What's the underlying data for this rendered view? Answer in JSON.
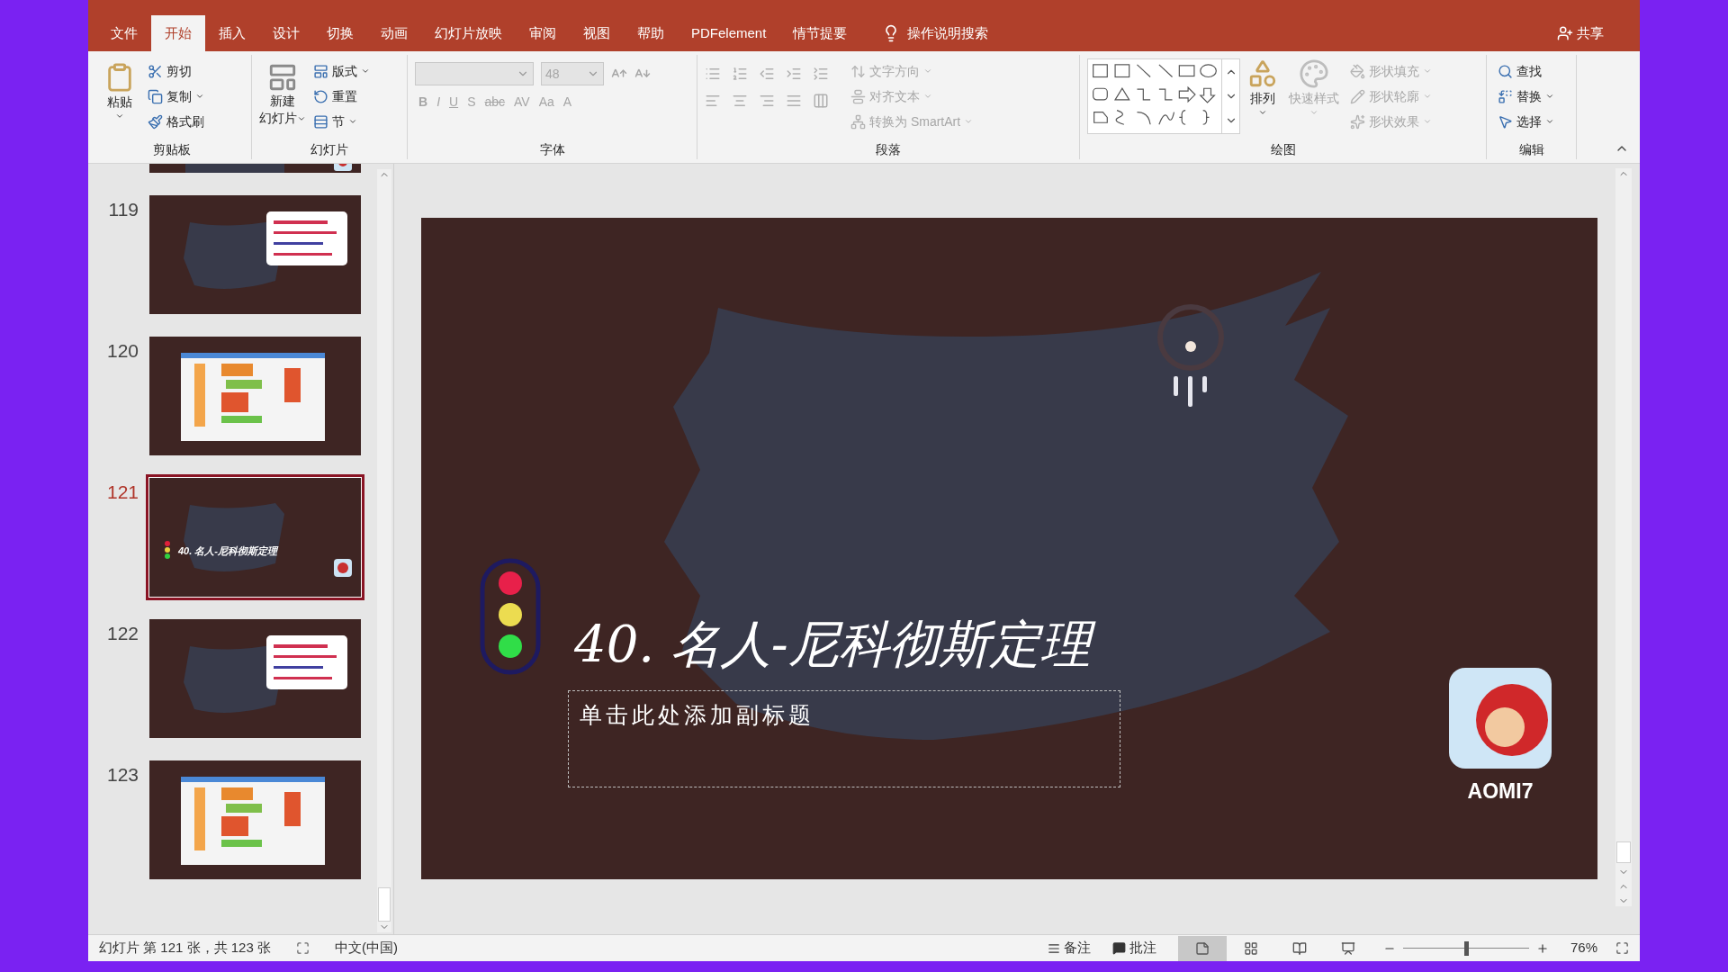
{
  "tabs": [
    {
      "label": "文件",
      "selected": false
    },
    {
      "label": "开始",
      "selected": true
    },
    {
      "label": "插入",
      "selected": false
    },
    {
      "label": "设计",
      "selected": false
    },
    {
      "label": "切换",
      "selected": false
    },
    {
      "label": "动画",
      "selected": false
    },
    {
      "label": "幻灯片放映",
      "selected": false
    },
    {
      "label": "审阅",
      "selected": false
    },
    {
      "label": "视图",
      "selected": false
    },
    {
      "label": "帮助",
      "selected": false
    },
    {
      "label": "PDFelement",
      "selected": false
    },
    {
      "label": "情节提要",
      "selected": false
    }
  ],
  "tell_me": "操作说明搜索",
  "share": "共享",
  "ribbon": {
    "clipboard": {
      "label": "剪贴板",
      "paste": "粘贴",
      "items": [
        {
          "kind": "cut",
          "label": "剪切",
          "disabled": false
        },
        {
          "kind": "copy",
          "label": "复制",
          "disabled": false
        },
        {
          "kind": "brush",
          "label": "格式刷",
          "disabled": false
        }
      ]
    },
    "slides": {
      "label": "幻灯片",
      "new_slide": [
        "新建",
        "幻灯片"
      ],
      "items": [
        {
          "kind": "layout",
          "label": "版式",
          "disabled": false
        },
        {
          "kind": "reset",
          "label": "重置",
          "disabled": false
        },
        {
          "kind": "section",
          "label": "节",
          "disabled": false
        }
      ]
    },
    "font": {
      "label": "字体",
      "size": "48",
      "disabled": true,
      "buttons": [
        "B",
        "I",
        "U",
        "S",
        "abc",
        "AV",
        "Aa",
        "A"
      ]
    },
    "paragraph": {
      "label": "段落",
      "items": [
        {
          "kind": "direction",
          "label": "文字方向",
          "disabled": true
        },
        {
          "kind": "align",
          "label": "对齐文本",
          "disabled": true
        },
        {
          "kind": "smartart",
          "label": "转换为 SmartArt",
          "disabled": true
        }
      ]
    },
    "drawing": {
      "label": "绘图",
      "arrange": "排列",
      "quick_styles": {
        "label": "快速样式",
        "disabled": true
      },
      "items": [
        {
          "kind": "fill",
          "label": "形状填充",
          "disabled": true
        },
        {
          "kind": "outline",
          "label": "形状轮廓",
          "disabled": true
        },
        {
          "kind": "effects",
          "label": "形状效果",
          "disabled": true
        }
      ]
    },
    "editing": {
      "label": "编辑",
      "items": [
        {
          "kind": "find",
          "label": "查找"
        },
        {
          "kind": "replace",
          "label": "替换"
        },
        {
          "kind": "select",
          "label": "选择"
        }
      ]
    }
  },
  "thumbnails": [
    {
      "kind": "logo",
      "selected": false
    },
    {
      "number": "119",
      "kind": "text",
      "selected": false
    },
    {
      "number": "120",
      "kind": "screen",
      "selected": false
    },
    {
      "number": "121",
      "kind": "title",
      "title": "40. 名人-尼科彻斯定理",
      "selected": true
    },
    {
      "number": "122",
      "kind": "text",
      "selected": false
    },
    {
      "number": "123",
      "kind": "screen",
      "selected": false
    }
  ],
  "slide": {
    "title": "40. 名人-尼科彻斯定理",
    "subtitle_placeholder": "单击此处添加副标题",
    "logo_text": "AOMI7"
  },
  "status_bar": {
    "slide_info": "幻灯片 第 121 张，共 123 张",
    "language": "中文(中国)",
    "notes": "备注",
    "comments": "批注",
    "views": [
      {
        "kind": "normal",
        "selected": true
      },
      {
        "kind": "sorter",
        "selected": false
      },
      {
        "kind": "reading",
        "selected": false
      },
      {
        "kind": "show",
        "selected": false
      }
    ],
    "zoom": {
      "level": 0.5,
      "reading": "76%"
    }
  }
}
